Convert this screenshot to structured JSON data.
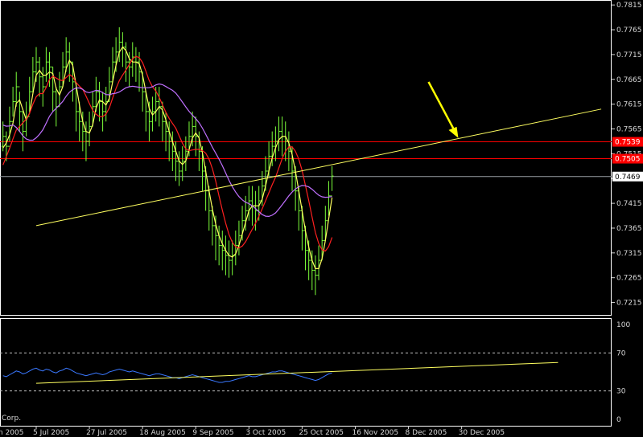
{
  "chart_data": [
    {
      "type": "line",
      "panel": "price",
      "title": "",
      "price_ticks": [
        "0.7815",
        "0.7765",
        "0.7715",
        "0.7665",
        "0.7615",
        "0.7565",
        "0.7515",
        "0.7465",
        "0.7415",
        "0.7365",
        "0.7315",
        "0.7265",
        "0.7215"
      ],
      "ylim": [
        0.719,
        0.7825
      ],
      "date_ticks": [
        "5 Jul 2005",
        "27 Jul 2005",
        "18 Aug 2005",
        "9 Sep 2005",
        "3 Oct 2005",
        "25 Oct 2005",
        "16 Nov 2005",
        "8 Dec 2005",
        "30 Dec 2005"
      ],
      "date_tick_bar_index": [
        0,
        16,
        32,
        48,
        64,
        80,
        96,
        112,
        128
      ],
      "left_partial_date": "n 2005",
      "price_marks": [
        {
          "label": "0.7539",
          "value": 0.7539,
          "color": "#ff0000",
          "kind": "red-horizontal"
        },
        {
          "label": "0.7505",
          "value": 0.7505,
          "color": "#ff0000",
          "kind": "red-horizontal"
        },
        {
          "label": "0.7469",
          "value": 0.7469,
          "color": "#ffffff",
          "kind": "current-price"
        }
      ],
      "series": [
        {
          "color": "#7cff3a",
          "bars": {
            "start_index": -27,
            "close": [
              0.776,
              0.7775,
              0.7745,
              0.772,
              0.769,
              0.768,
              0.76,
              0.752,
              0.746,
              0.742,
              0.74,
              0.744,
              0.747,
              0.751,
              0.754,
              0.75,
              0.753,
              0.755,
              0.753,
              0.758,
              0.762,
              0.765,
              0.76,
              0.756,
              0.759,
              0.764,
              0.768,
              0.77,
              0.767,
              0.765,
              0.77,
              0.769,
              0.764,
              0.761,
              0.765,
              0.769,
              0.772,
              0.77,
              0.766,
              0.76,
              0.758,
              0.756,
              0.754,
              0.757,
              0.761,
              0.764,
              0.762,
              0.76,
              0.762,
              0.766,
              0.77,
              0.772,
              0.774,
              0.773,
              0.77,
              0.769,
              0.771,
              0.77,
              0.768,
              0.764,
              0.76,
              0.758,
              0.76,
              0.762,
              0.761,
              0.758,
              0.756,
              0.754,
              0.752,
              0.75,
              0.748,
              0.75,
              0.752,
              0.755,
              0.757,
              0.755,
              0.752,
              0.748,
              0.744,
              0.74,
              0.737,
              0.735,
              0.733,
              0.732,
              0.731,
              0.73,
              0.731,
              0.733,
              0.735,
              0.738,
              0.74,
              0.742,
              0.741,
              0.74,
              0.742,
              0.745,
              0.748,
              0.751,
              0.753,
              0.754,
              0.756,
              0.755,
              0.754,
              0.752,
              0.748,
              0.744,
              0.74,
              0.736,
              0.732,
              0.73,
              0.728,
              0.727,
              0.73,
              0.734,
              0.738,
              0.743,
              0.747
            ],
            "high": [
              0.7775,
              0.779,
              0.777,
              0.7745,
              0.772,
              0.771,
              0.769,
              0.76,
              0.753,
              0.747,
              0.744,
              0.747,
              0.75,
              0.754,
              0.757,
              0.754,
              0.756,
              0.758,
              0.756,
              0.761,
              0.765,
              0.768,
              0.764,
              0.76,
              0.762,
              0.767,
              0.771,
              0.773,
              0.771,
              0.769,
              0.773,
              0.772,
              0.769,
              0.765,
              0.768,
              0.772,
              0.775,
              0.774,
              0.77,
              0.765,
              0.762,
              0.76,
              0.758,
              0.76,
              0.764,
              0.767,
              0.766,
              0.764,
              0.765,
              0.769,
              0.773,
              0.775,
              0.777,
              0.776,
              0.774,
              0.772,
              0.774,
              0.773,
              0.772,
              0.768,
              0.764,
              0.762,
              0.763,
              0.765,
              0.765,
              0.762,
              0.76,
              0.758,
              0.756,
              0.754,
              0.752,
              0.753,
              0.755,
              0.758,
              0.76,
              0.759,
              0.756,
              0.753,
              0.749,
              0.745,
              0.741,
              0.739,
              0.737,
              0.736,
              0.735,
              0.734,
              0.734,
              0.736,
              0.738,
              0.741,
              0.743,
              0.745,
              0.745,
              0.744,
              0.745,
              0.748,
              0.751,
              0.754,
              0.756,
              0.757,
              0.759,
              0.759,
              0.758,
              0.756,
              0.753,
              0.749,
              0.745,
              0.741,
              0.737,
              0.734,
              0.732,
              0.731,
              0.733,
              0.737,
              0.741,
              0.746,
              0.749
            ],
            "low": [
              0.773,
              0.7745,
              0.772,
              0.769,
              0.766,
              0.764,
              0.756,
              0.748,
              0.742,
              0.7375,
              0.7365,
              0.74,
              0.744,
              0.748,
              0.75,
              0.747,
              0.75,
              0.752,
              0.75,
              0.754,
              0.759,
              0.761,
              0.756,
              0.752,
              0.755,
              0.76,
              0.764,
              0.766,
              0.763,
              0.761,
              0.766,
              0.765,
              0.76,
              0.757,
              0.761,
              0.765,
              0.768,
              0.766,
              0.762,
              0.756,
              0.754,
              0.752,
              0.75,
              0.753,
              0.757,
              0.76,
              0.758,
              0.756,
              0.758,
              0.762,
              0.766,
              0.768,
              0.77,
              0.769,
              0.766,
              0.765,
              0.767,
              0.766,
              0.764,
              0.76,
              0.756,
              0.754,
              0.756,
              0.758,
              0.757,
              0.754,
              0.752,
              0.75,
              0.748,
              0.746,
              0.745,
              0.746,
              0.748,
              0.751,
              0.753,
              0.751,
              0.748,
              0.744,
              0.74,
              0.736,
              0.733,
              0.73,
              0.729,
              0.728,
              0.727,
              0.7265,
              0.727,
              0.729,
              0.731,
              0.734,
              0.736,
              0.738,
              0.737,
              0.736,
              0.738,
              0.741,
              0.744,
              0.747,
              0.749,
              0.75,
              0.752,
              0.751,
              0.75,
              0.748,
              0.744,
              0.74,
              0.736,
              0.732,
              0.728,
              0.726,
              0.724,
              0.723,
              0.726,
              0.73,
              0.734,
              0.739,
              0.744
            ]
          }
        },
        {
          "color": "#ffff60",
          "kind": "fast-ma"
        },
        {
          "color": "#ff2020",
          "kind": "slow-ma"
        },
        {
          "color": "#c070ff",
          "kind": "long-ma"
        }
      ],
      "trendlines": [
        {
          "color": "#ffff60",
          "from": {
            "bar": 0,
            "value": 0.737
          },
          "to": {
            "bar": 170,
            "value": 0.7605
          }
        }
      ],
      "annotations": [
        {
          "type": "arrow",
          "color": "#ffff00",
          "points_to": {
            "bar": 127,
            "value": 0.754
          }
        }
      ]
    },
    {
      "type": "line",
      "panel": "oscillator",
      "ylim": [
        0,
        100
      ],
      "y_ticks": [
        "100",
        "70",
        "30",
        "0"
      ],
      "levels": [
        70,
        30
      ],
      "corner_text": "Corp.",
      "series": [
        {
          "color": "#3a78ff",
          "start_index": -27,
          "values": [
            50,
            49,
            48,
            46,
            45,
            44,
            42,
            40,
            38,
            37,
            38,
            40,
            42,
            43,
            44,
            43,
            44,
            46,
            45,
            47,
            49,
            51,
            50,
            48,
            49,
            51,
            53,
            54,
            52,
            51,
            53,
            52,
            50,
            49,
            51,
            52,
            54,
            53,
            51,
            49,
            48,
            47,
            46,
            47,
            48,
            49,
            48,
            47,
            48,
            50,
            51,
            52,
            53,
            52,
            51,
            50,
            51,
            50,
            49,
            48,
            47,
            46,
            47,
            48,
            48,
            47,
            46,
            45,
            44,
            44,
            43,
            44,
            45,
            46,
            47,
            46,
            45,
            44,
            43,
            42,
            41,
            40,
            39,
            39,
            40,
            40,
            41,
            42,
            43,
            44,
            45,
            46,
            45,
            45,
            46,
            47,
            48,
            49,
            50,
            50,
            51,
            51,
            50,
            49,
            48,
            47,
            46,
            45,
            44,
            43,
            42,
            41,
            42,
            44,
            46,
            48,
            49
          ]
        }
      ],
      "trendlines": [
        {
          "color": "#ffff60",
          "from": {
            "bar": 0,
            "value": 38
          },
          "to": {
            "bar": 157,
            "value": 60
          }
        }
      ]
    }
  ]
}
